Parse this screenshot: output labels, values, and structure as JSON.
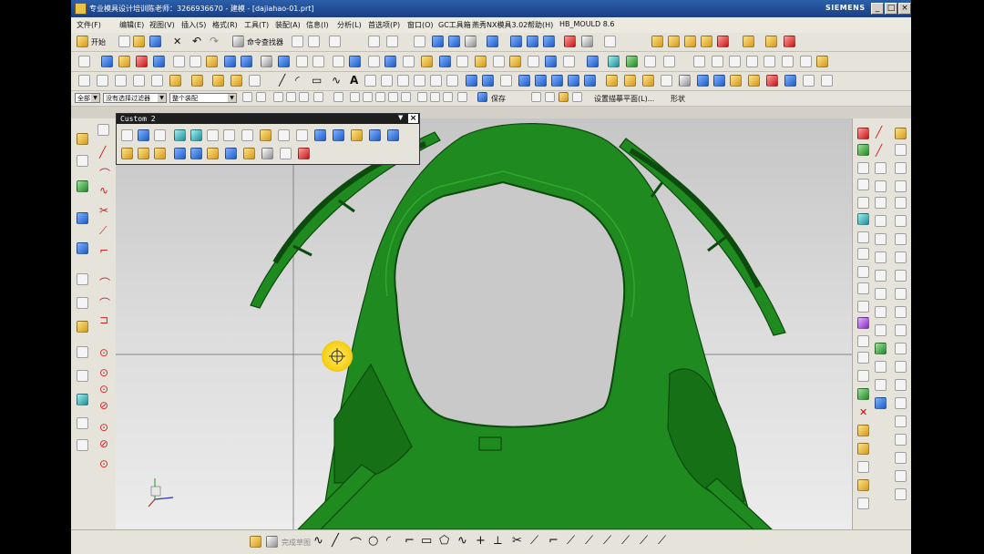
{
  "window": {
    "title": "专业模具设计培训陈老师：3266936670 - 建模 - [dajiahao-01.prt]",
    "brand": "SIEMENS",
    "minimize": "_",
    "maximize": "□",
    "close": "×"
  },
  "menu": [
    "文件(F)",
    "编辑(E)",
    "视图(V)",
    "插入(S)",
    "格式(R)",
    "工具(T)",
    "装配(A)",
    "信息(I)",
    "分析(L)",
    "首选项(P)",
    "窗口(O)",
    "GC工具箱",
    "燕秀NX模具3.02",
    "帮助(H)",
    "HB_MOULD 8.6"
  ],
  "toolbar1": {
    "start_label": "开始",
    "command_finder_label": "命令查找器"
  },
  "toolbar4": {
    "filter_value": "全部",
    "selection_filter_value": "没有选择过滤器",
    "assembly_scope_value": "整个装配",
    "save_label": "保存",
    "work_plane_label": "设置描摹平面(L)...",
    "shape_label": "形状"
  },
  "custom_toolbar": {
    "title": "Custom 2"
  },
  "bottom_toolbar": {
    "sketch_label": "完成草图"
  },
  "colors": {
    "model_green": "#1f8a1f",
    "model_edge": "#0d4a0d",
    "cursor_highlight": "#f7d21a"
  }
}
